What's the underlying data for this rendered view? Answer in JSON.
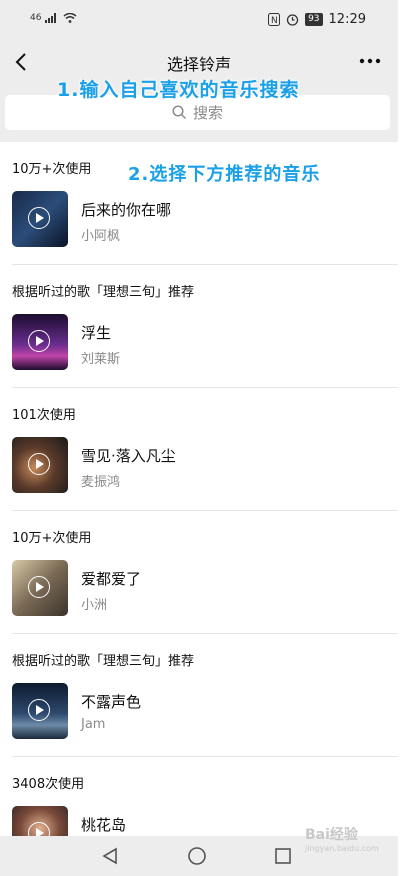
{
  "status_bar": {
    "signal": "46",
    "battery": "93",
    "time": "12:29"
  },
  "nav": {
    "title": "选择铃声"
  },
  "search": {
    "placeholder": "搜索"
  },
  "annotations": {
    "step1": "1.输入自己喜欢的音乐搜索",
    "step2": "2.选择下方推荐的音乐"
  },
  "sections": [
    {
      "header": "10万+次使用",
      "song": "后来的你在哪",
      "artist": "小阿枫"
    },
    {
      "header": "根据听过的歌「理想三旬」推荐",
      "song": "浮生",
      "artist": "刘莱斯"
    },
    {
      "header": "101次使用",
      "song": "雪见·落入凡尘",
      "artist": "麦振鸿"
    },
    {
      "header": "10万+次使用",
      "song": "爱都爱了",
      "artist": "小洲"
    },
    {
      "header": "根据听过的歌「理想三旬」推荐",
      "song": "不露声色",
      "artist": "Jam"
    },
    {
      "header": "3408次使用",
      "song": "桃花岛",
      "artist": ""
    }
  ],
  "watermark": {
    "text": "Bai经验",
    "sub": "jingyan.baidu.com"
  },
  "colors": {
    "annotation": "#1aa0e8",
    "background": "#ededed"
  }
}
